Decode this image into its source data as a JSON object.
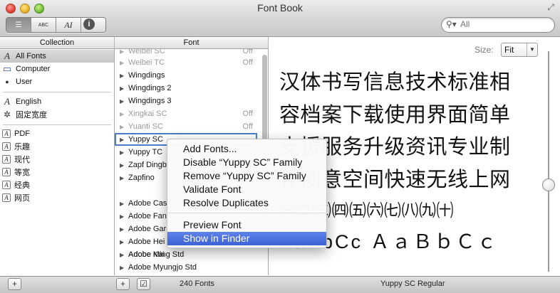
{
  "window": {
    "title": "Font Book"
  },
  "toolbar": {
    "view_buttons": [
      {
        "icon": "list-icon",
        "glyph": "☰"
      },
      {
        "icon": "grid-abc-icon",
        "glyph": "ABC"
      },
      {
        "icon": "font-preview-icon",
        "glyph": "AI"
      }
    ],
    "info_glyph": "i"
  },
  "search": {
    "placeholder": "All"
  },
  "columns": {
    "collection": "Collection",
    "font": "Font"
  },
  "collections": [
    {
      "label": "All Fonts",
      "icon": "font-icon",
      "glyph": "A"
    },
    {
      "label": "Computer",
      "icon": "computer-icon",
      "glyph": "▭"
    },
    {
      "label": "User",
      "icon": "user-icon",
      "glyph": "●"
    },
    {
      "label": "English",
      "icon": "font-icon",
      "glyph": "A"
    },
    {
      "label": "固定宽度",
      "icon": "gear-icon",
      "glyph": "✲"
    },
    {
      "label": "PDF",
      "icon": "collection-box-icon",
      "glyph": "A"
    },
    {
      "label": "乐趣",
      "icon": "collection-box-icon",
      "glyph": "A"
    },
    {
      "label": "现代",
      "icon": "collection-box-icon",
      "glyph": "A"
    },
    {
      "label": "等宽",
      "icon": "collection-box-icon",
      "glyph": "A"
    },
    {
      "label": "经典",
      "icon": "collection-box-icon",
      "glyph": "A"
    },
    {
      "label": "网页",
      "icon": "collection-box-icon",
      "glyph": "A"
    }
  ],
  "fonts": [
    {
      "name": "Weibei SC",
      "status": "Off"
    },
    {
      "name": "Weibei TC",
      "status": "Off"
    },
    {
      "name": "Wingdings",
      "status": ""
    },
    {
      "name": "Wingdings 2",
      "status": ""
    },
    {
      "name": "Wingdings 3",
      "status": ""
    },
    {
      "name": "Xingkai SC",
      "status": "Off"
    },
    {
      "name": "Yuanti SC",
      "status": "Off"
    },
    {
      "name": "Yuppy SC",
      "status": ""
    },
    {
      "name": "Yuppy TC",
      "status": ""
    },
    {
      "name": "Zapf Dingb",
      "status": ""
    },
    {
      "name": "Zapfino",
      "status": ""
    },
    {
      "name": "Adobe Cas",
      "status": ""
    },
    {
      "name": "Adobe Fan",
      "status": ""
    },
    {
      "name": "Adobe Gar",
      "status": ""
    },
    {
      "name": "Adobe Hei",
      "status": ""
    },
    {
      "name": "Adobe Kai",
      "status": ""
    },
    {
      "name": "Adobe Ming Std",
      "status": ""
    },
    {
      "name": "Adobe Myungjo Std",
      "status": ""
    }
  ],
  "context_menu": {
    "items": [
      "Add Fonts...",
      "Disable “Yuppy SC” Family",
      "Remove “Yuppy SC” Family",
      "Validate Font",
      "Resolve Duplicates",
      "Preview Font",
      "Show in Finder"
    ],
    "highlighted": "Show in Finder"
  },
  "preview": {
    "size_label": "Size:",
    "size_value": "Fit",
    "lines": [
      "汉体书写信息技术标准相",
      "容档案下载使用界面简单",
      "支援服务升级资讯专业制",
      "作创意空间快速无线上网",
      "㈠㈡㈢㈣㈤㈥㈦㈧㈨㈩",
      "AaBbCc ＡａＢｂＣｃ"
    ]
  },
  "status": {
    "add_glyph": "+",
    "check_glyph": "☑",
    "font_count": "240 Fonts",
    "selected_font": "Yuppy SC Regular"
  },
  "colors": {
    "selection": "#3c63d8",
    "focus_ring": "#4a7ccf"
  }
}
